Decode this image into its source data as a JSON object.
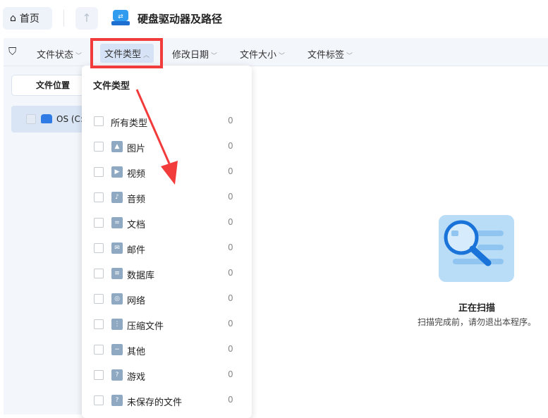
{
  "header": {
    "home_label": "首页",
    "title": "硬盘驱动器及路径"
  },
  "filters": [
    {
      "label": "文件状态",
      "state": "collapsed"
    },
    {
      "label": "文件类型",
      "state": "expanded"
    },
    {
      "label": "修改日期",
      "state": "collapsed"
    },
    {
      "label": "文件大小",
      "state": "collapsed"
    },
    {
      "label": "文件标签",
      "state": "collapsed"
    }
  ],
  "left": {
    "location_button": "文件位置",
    "drive_label": "OS (C:"
  },
  "menu": {
    "title": "文件类型",
    "items": [
      {
        "label": "所有类型",
        "count": "0",
        "icon": ""
      },
      {
        "label": "图片",
        "count": "0",
        "icon": "image-icon"
      },
      {
        "label": "视频",
        "count": "0",
        "icon": "video-icon"
      },
      {
        "label": "音频",
        "count": "0",
        "icon": "audio-icon"
      },
      {
        "label": "文档",
        "count": "0",
        "icon": "document-icon"
      },
      {
        "label": "邮件",
        "count": "0",
        "icon": "mail-icon"
      },
      {
        "label": "数据库",
        "count": "0",
        "icon": "database-icon"
      },
      {
        "label": "网络",
        "count": "0",
        "icon": "network-icon"
      },
      {
        "label": "压缩文件",
        "count": "0",
        "icon": "archive-icon"
      },
      {
        "label": "其他",
        "count": "0",
        "icon": "other-icon"
      },
      {
        "label": "游戏",
        "count": "0",
        "icon": "game-icon"
      },
      {
        "label": "未保存的文件",
        "count": "0",
        "icon": "unsaved-icon"
      }
    ]
  },
  "status": {
    "title": "正在扫描",
    "subtitle": "扫描完成前，请勿退出本程序。"
  },
  "colors": {
    "highlight": "#f23b3b",
    "accent": "#2f7be5"
  }
}
